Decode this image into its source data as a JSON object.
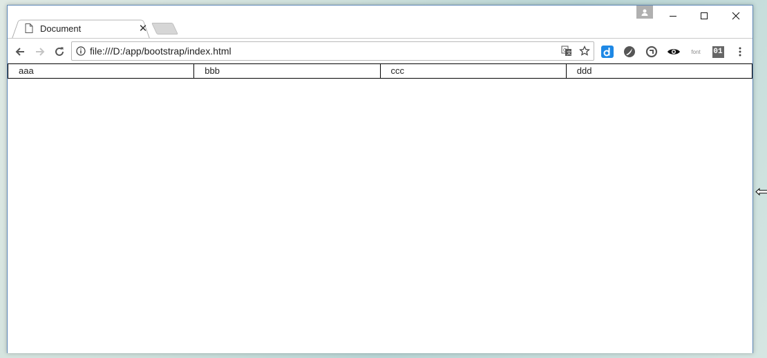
{
  "tab": {
    "title": "Document",
    "close": "✕"
  },
  "address": {
    "url": "file:///D:/app/bootstrap/index.html"
  },
  "extensions": {
    "font_label": "font",
    "binary_label": "01"
  },
  "page": {
    "cells": [
      "aaa",
      "bbb",
      "ccc",
      "ddd"
    ]
  }
}
